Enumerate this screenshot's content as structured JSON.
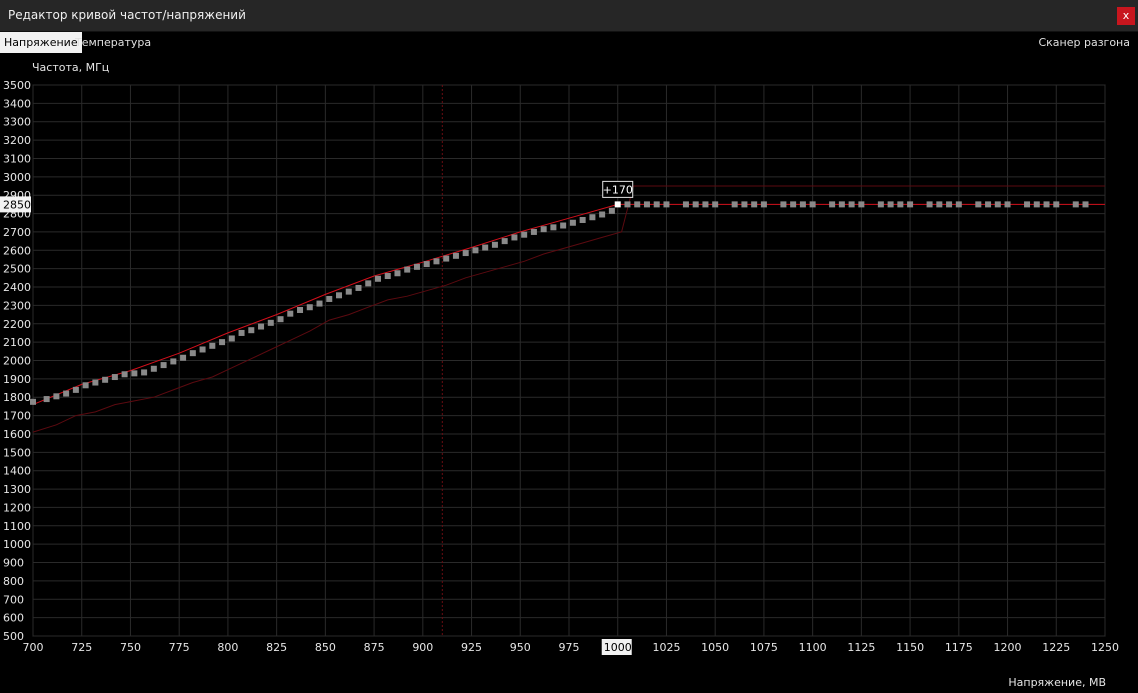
{
  "window": {
    "title": "Редактор кривой частот/напряжений",
    "close_label": "x"
  },
  "tabs": {
    "voltage": "Напряжение",
    "temperature": "Температура",
    "scanner": "Сканер разгона"
  },
  "chart_data": {
    "type": "line",
    "ylabel": "Частота, МГц",
    "xlabel": "Напряжение, МВ",
    "xlim": [
      700,
      1250
    ],
    "ylim": [
      500,
      3500
    ],
    "x_ticks": [
      700,
      725,
      750,
      775,
      800,
      825,
      850,
      875,
      900,
      925,
      950,
      975,
      1000,
      1025,
      1050,
      1075,
      1100,
      1125,
      1150,
      1175,
      1200,
      1225,
      1250
    ],
    "y_ticks": [
      500,
      600,
      700,
      800,
      900,
      1000,
      1100,
      1200,
      1300,
      1400,
      1500,
      1600,
      1700,
      1800,
      1900,
      2000,
      2100,
      2200,
      2300,
      2400,
      2500,
      2600,
      2700,
      2800,
      2900,
      3000,
      3100,
      3200,
      3300,
      3400,
      3500
    ],
    "grid": true,
    "highlighted_x_label": "1000",
    "highlighted_y_label": "2850",
    "cursor_x": 910,
    "offset_label": "+170",
    "selected_point": [
      1000,
      2850
    ],
    "colors": {
      "background": "#000000",
      "grid": "#2a2a2a",
      "curve": "#d4101c",
      "base_curve": "#5c0a10",
      "points": "#8a8a8a",
      "selected_point": "#ffffff"
    },
    "series": [
      {
        "role": "points",
        "x": [
          700,
          707,
          712,
          717,
          722,
          727,
          732,
          737,
          742,
          747,
          752,
          757,
          762,
          767,
          772,
          777,
          782,
          787,
          792,
          797,
          802,
          807,
          812,
          817,
          822,
          827,
          832,
          837,
          842,
          847,
          852,
          857,
          862,
          867,
          872,
          877,
          882,
          887,
          892,
          897,
          902,
          907,
          912,
          917,
          922,
          927,
          932,
          937,
          942,
          947,
          952,
          957,
          962,
          967,
          972,
          977,
          982,
          987,
          992,
          997,
          1000,
          1005,
          1010,
          1015,
          1020,
          1025,
          1035,
          1040,
          1045,
          1050,
          1060,
          1065,
          1070,
          1075,
          1085,
          1090,
          1095,
          1100,
          1110,
          1115,
          1120,
          1125,
          1135,
          1140,
          1145,
          1150,
          1160,
          1165,
          1170,
          1175,
          1185,
          1190,
          1195,
          1200,
          1210,
          1215,
          1220,
          1225,
          1235,
          1240
        ],
        "y": [
          1775,
          1790,
          1805,
          1820,
          1840,
          1865,
          1880,
          1895,
          1910,
          1925,
          1930,
          1935,
          1955,
          1975,
          1995,
          2015,
          2040,
          2060,
          2080,
          2100,
          2120,
          2150,
          2165,
          2185,
          2205,
          2225,
          2255,
          2275,
          2290,
          2310,
          2335,
          2355,
          2375,
          2395,
          2420,
          2445,
          2460,
          2475,
          2495,
          2510,
          2525,
          2540,
          2555,
          2570,
          2585,
          2600,
          2615,
          2630,
          2650,
          2670,
          2685,
          2700,
          2715,
          2725,
          2735,
          2750,
          2765,
          2780,
          2795,
          2815,
          2850,
          2850,
          2850,
          2850,
          2850,
          2850,
          2850,
          2850,
          2850,
          2850,
          2850,
          2850,
          2850,
          2850,
          2850,
          2850,
          2850,
          2850,
          2850,
          2850,
          2850,
          2850,
          2850,
          2850,
          2850,
          2850,
          2850,
          2850,
          2850,
          2850,
          2850,
          2850,
          2850,
          2850,
          2850,
          2850,
          2850,
          2850,
          2850,
          2850
        ]
      },
      {
        "role": "curve",
        "x": [
          700,
          725,
          750,
          775,
          800,
          825,
          850,
          875,
          900,
          925,
          950,
          975,
          1000,
          1010,
          1250
        ],
        "y": [
          1760,
          1870,
          1945,
          2040,
          2150,
          2250,
          2360,
          2460,
          2535,
          2615,
          2700,
          2775,
          2850,
          2850,
          2850
        ]
      },
      {
        "role": "base_curve",
        "x": [
          700,
          712,
          722,
          732,
          742,
          752,
          762,
          772,
          782,
          792,
          802,
          812,
          822,
          832,
          842,
          852,
          862,
          872,
          882,
          892,
          902,
          912,
          922,
          932,
          942,
          952,
          962,
          972,
          982,
          992,
          1002,
          1008,
          1250
        ],
        "y": [
          1610,
          1650,
          1700,
          1720,
          1760,
          1780,
          1800,
          1840,
          1880,
          1910,
          1960,
          2010,
          2060,
          2110,
          2160,
          2220,
          2250,
          2290,
          2330,
          2350,
          2380,
          2410,
          2450,
          2480,
          2510,
          2540,
          2580,
          2610,
          2640,
          2670,
          2700,
          2950,
          2950
        ]
      }
    ]
  }
}
